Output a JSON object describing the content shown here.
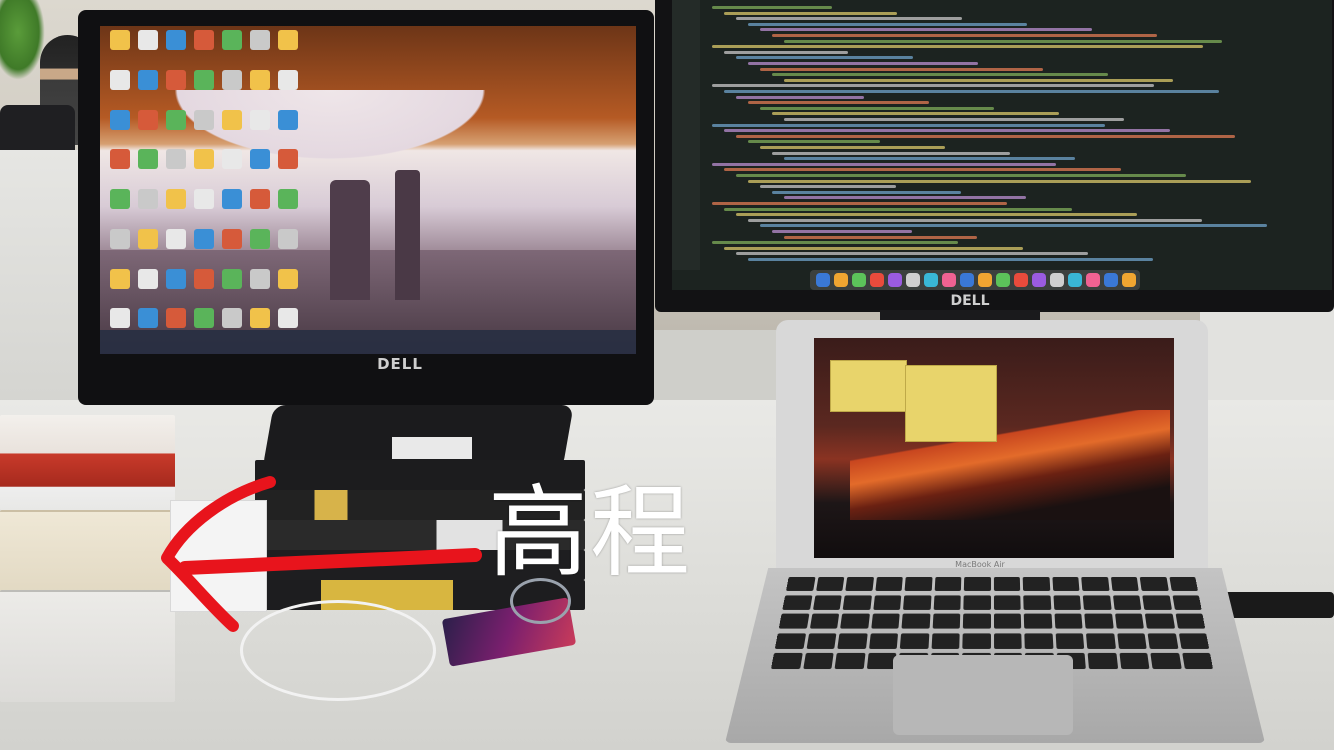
{
  "annotation": {
    "label": "高程",
    "arrow_color": "#e8141c",
    "text_color": "#ffffff"
  },
  "scene": {
    "left_monitor_brand": "DELL",
    "right_monitor_brand": "DELL",
    "laptop_brand": "MacBook Air"
  }
}
